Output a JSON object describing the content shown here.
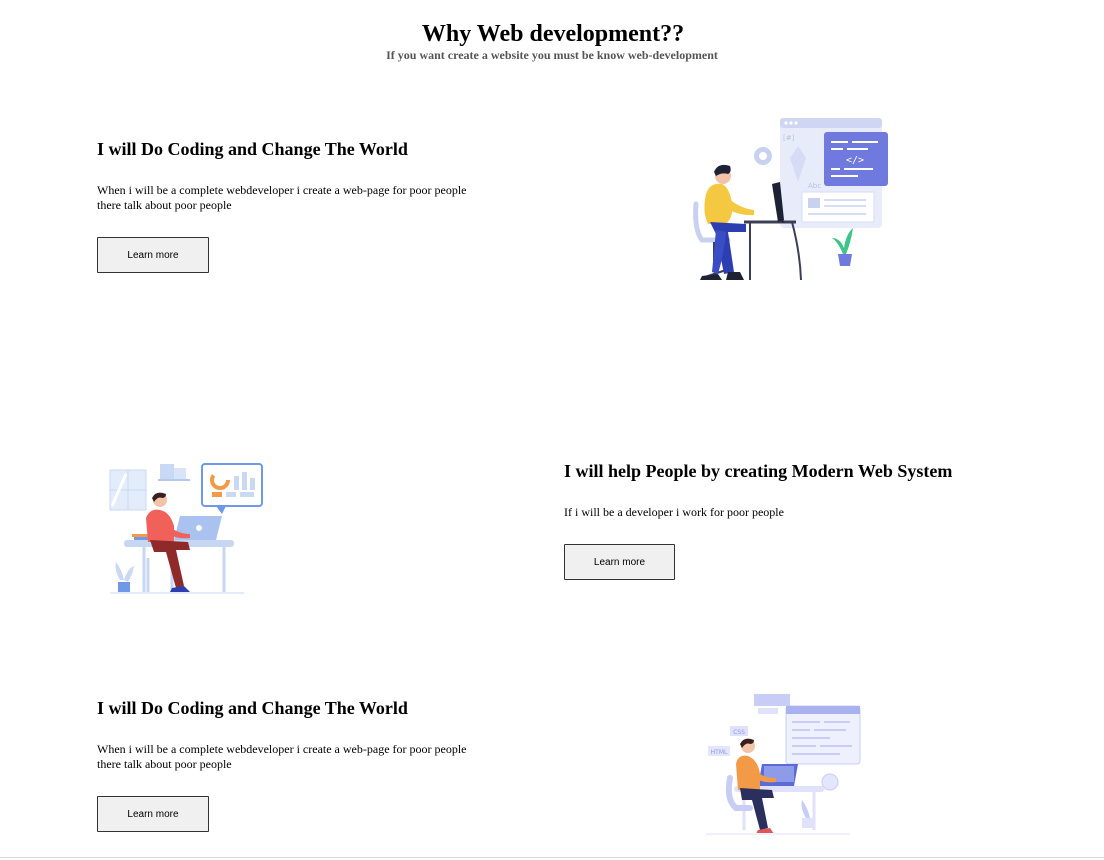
{
  "header": {
    "title": "Why Web development??",
    "subtitle": "If you want create a website you must be know web-development"
  },
  "sections": [
    {
      "heading": "I will Do Coding and Change The World",
      "text": "When i will be a complete webdeveloper i create a web-page for poor people there talk about poor people",
      "button": "Learn more"
    },
    {
      "heading": "I will help People by creating Modern Web System",
      "text": "If i will be a developer i work for poor people",
      "button": "Learn more"
    },
    {
      "heading": "I will Do Coding and Change The World",
      "text": "When i will be a complete webdeveloper i create a web-page for poor people there talk about poor people",
      "button": "Learn more"
    }
  ],
  "illustrations": [
    {
      "icon": "developer-coding-illustration",
      "code_label": "</>",
      "tag_label": "[#]",
      "text_label": "Abc"
    },
    {
      "icon": "developer-laptop-analytics-illustration"
    },
    {
      "icon": "developer-code-editor-illustration",
      "tag_label": "CSS",
      "html_label": "HTML"
    }
  ]
}
